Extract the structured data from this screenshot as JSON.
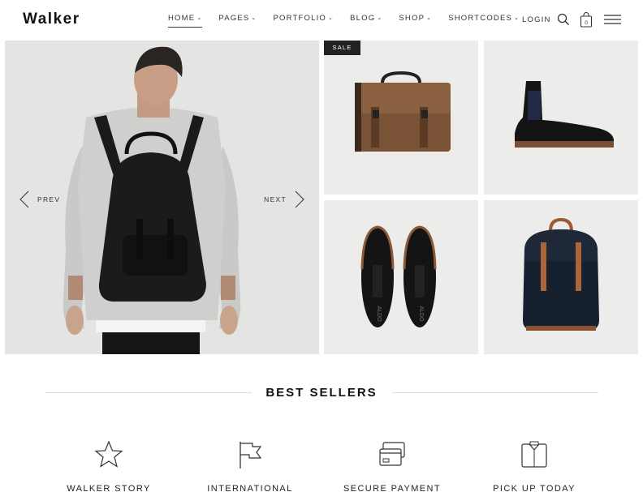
{
  "header": {
    "logo": "Walker",
    "nav": [
      {
        "label": "HOME",
        "active": true
      },
      {
        "label": "PAGES"
      },
      {
        "label": "PORTFOLIO"
      },
      {
        "label": "BLOG"
      },
      {
        "label": "SHOP"
      },
      {
        "label": "SHORTCODES"
      }
    ],
    "login": "LOGIN",
    "cart_count": "0",
    "icons": [
      "search-icon",
      "cart-icon",
      "hamburger-menu-icon"
    ]
  },
  "hero": {
    "prev_label": "PREV",
    "next_label": "NEXT"
  },
  "products": {
    "sale_badge": "SALE",
    "items": [
      "satchel-bag",
      "chelsea-boot",
      "oxford-shoes",
      "backpack"
    ],
    "shoe_brand": "ALDO"
  },
  "best_sellers": {
    "title": "BEST SELLERS"
  },
  "features": [
    {
      "label": "WALKER STORY",
      "icon": "star-icon"
    },
    {
      "label": "INTERNATIONAL",
      "icon": "flag-icon"
    },
    {
      "label": "SECURE PAYMENT",
      "icon": "credit-card-icon"
    },
    {
      "label": "PICK UP TODAY",
      "icon": "shirt-box-icon"
    }
  ]
}
